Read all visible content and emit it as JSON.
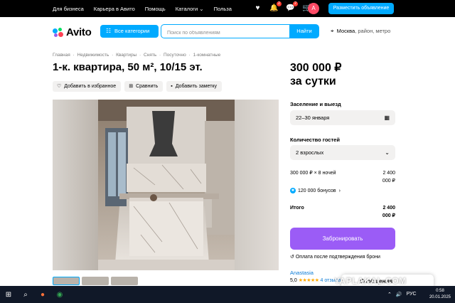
{
  "topbar": {
    "links": [
      "Для бизнеса",
      "Карьера в Авито",
      "Помощь",
      "Каталоги",
      "Польза"
    ],
    "catalog_chevron": "chevron-down-icon",
    "favorites_badge": "",
    "notifications_badge": "2",
    "messages_badge": "2",
    "avatar_letter": "A",
    "place_ad_label": "Разместить объявление"
  },
  "header": {
    "logo_text": "Avito",
    "categories_label": "Все категории",
    "search_placeholder": "Поиск по объявлениям",
    "search_button": "Найти",
    "location": "Москва",
    "location_suffix": ", район, метро"
  },
  "breadcrumbs": [
    "Главная",
    "·",
    "Недвижимость",
    "·",
    "Квартиры",
    "·",
    "Снять",
    "·",
    "Посуточно",
    "·",
    "1-комнатные"
  ],
  "listing": {
    "title": "1-к. квартира, 50 м², 10/15 эт.",
    "actions": {
      "favorite": "Добавить в избранное",
      "compare": "Сравнить",
      "note": "Добавить заметку"
    }
  },
  "booking": {
    "price": "300 000 ₽",
    "price_unit": "за сутки",
    "dates_label": "Заселение и выезд",
    "dates_value": "22–30 января",
    "guests_label": "Количество гостей",
    "guests_value": "2 взрослых",
    "nights_line": "300 000 ₽ × 8 ночей",
    "nights_total": "2 400 000 ₽",
    "bonus_text": "120 000 бонусов",
    "total_label": "Итого",
    "total_value": "2 400 000 ₽",
    "book_button": "Забронировать",
    "payment_note": "Оплата после подтверждения брони"
  },
  "seller": {
    "name": "Anastasia",
    "rating": "5,0",
    "stars": "★★★★★",
    "reviews": "4 отзыва"
  },
  "messenger": {
    "label": "Сообщения"
  },
  "watermark": "YAPLAKAL.COM",
  "taskbar": {
    "time": "0:58",
    "date": "20.01.2025",
    "lang": "РУС"
  },
  "colors": {
    "accent": "#00aaff",
    "book": "#9b5cf6",
    "star": "#ffa800"
  }
}
